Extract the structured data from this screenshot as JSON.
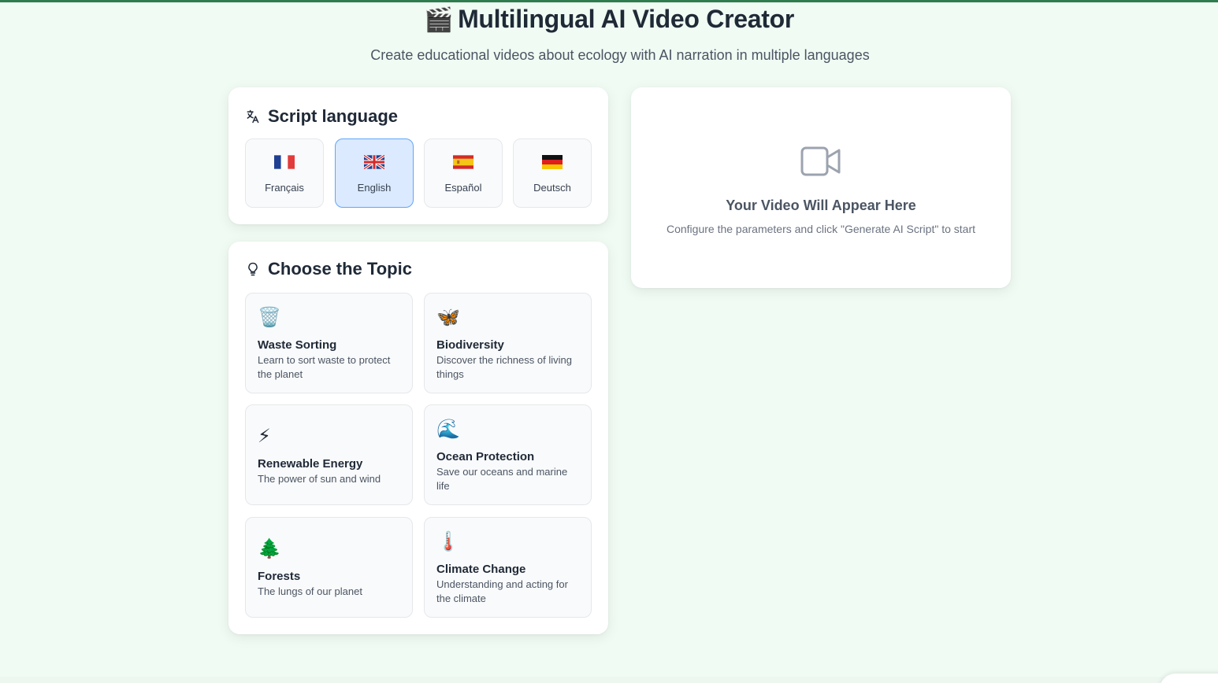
{
  "header": {
    "title_emoji": "🎬",
    "title": "Multilingual AI Video Creator",
    "subtitle": "Create educational videos about ecology with AI narration in multiple languages"
  },
  "language_card": {
    "title": "Script language",
    "icon": "translate-icon",
    "selected": "English",
    "languages": [
      {
        "label": "Français",
        "flag": "france-flag-icon"
      },
      {
        "label": "English",
        "flag": "uk-flag-icon"
      },
      {
        "label": "Español",
        "flag": "spain-flag-icon"
      },
      {
        "label": "Deutsch",
        "flag": "germany-flag-icon"
      }
    ]
  },
  "topic_card": {
    "title": "Choose the Topic",
    "icon": "lightbulb-icon",
    "topics": [
      {
        "icon": "🗑️",
        "name": "Waste Sorting",
        "description": "Learn to sort waste to protect the planet"
      },
      {
        "icon": "🦋",
        "name": "Biodiversity",
        "description": "Discover the richness of living things"
      },
      {
        "icon": "⚡",
        "name": "Renewable Energy",
        "description": "The power of sun and wind"
      },
      {
        "icon": "🌊",
        "name": "Ocean Protection",
        "description": "Save our oceans and marine life"
      },
      {
        "icon": "🌲",
        "name": "Forests",
        "description": "The lungs of our planet"
      },
      {
        "icon": "🌡️",
        "name": "Climate Change",
        "description": "Understanding and acting for the climate"
      }
    ]
  },
  "video_card": {
    "icon": "video-camera-icon",
    "title": "Your Video Will Appear Here",
    "description": "Configure the parameters and click \"Generate AI Script\" to start"
  },
  "colors": {
    "background": "#f0fbf3",
    "accent_bar": "#2f7d4f",
    "selected_bg": "#dbeafe",
    "selected_border": "#60a5fa"
  }
}
